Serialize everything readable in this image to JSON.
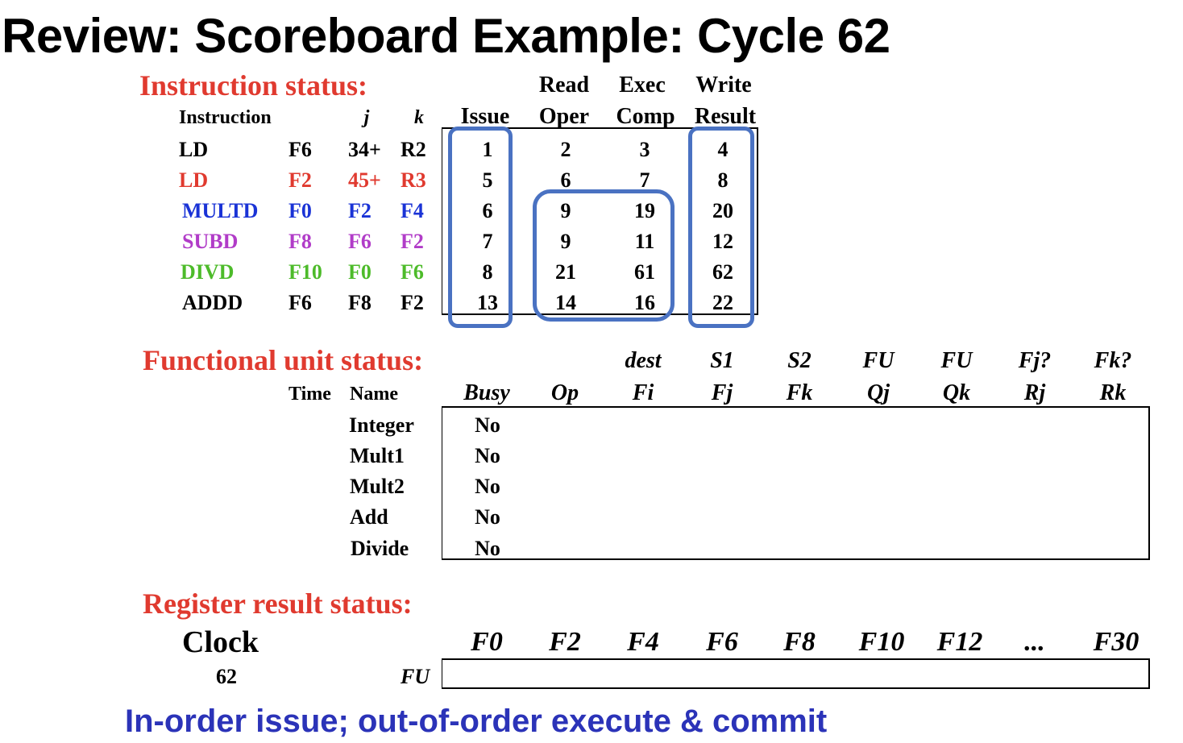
{
  "title": "Review: Scoreboard Example: Cycle 62",
  "colors": {
    "section": "#e03a2f",
    "highlight": "#4a72c2",
    "note": "#2b33b8",
    "row_colors": [
      "#000000",
      "#e03a2f",
      "#1a33d6",
      "#b13cc8",
      "#4dbb2a",
      "#000000"
    ]
  },
  "instruction_status": {
    "label": "Instruction status:",
    "headers": {
      "instruction": "Instruction",
      "j": "j",
      "k": "k",
      "issue": "Issue",
      "read_top": "Read",
      "read_bottom": "Oper",
      "exec_top": "Exec",
      "exec_bottom": "Comp",
      "write_top": "Write",
      "write_bottom": "Result"
    },
    "rows": [
      {
        "op": "LD",
        "dest": "F6",
        "j": "34+",
        "k": "R2",
        "issue": "1",
        "read": "2",
        "exec": "3",
        "write": "4"
      },
      {
        "op": "LD",
        "dest": "F2",
        "j": "45+",
        "k": "R3",
        "issue": "5",
        "read": "6",
        "exec": "7",
        "write": "8"
      },
      {
        "op": "MULTD",
        "dest": "F0",
        "j": "F2",
        "k": "F4",
        "issue": "6",
        "read": "9",
        "exec": "19",
        "write": "20"
      },
      {
        "op": "SUBD",
        "dest": "F8",
        "j": "F6",
        "k": "F2",
        "issue": "7",
        "read": "9",
        "exec": "11",
        "write": "12"
      },
      {
        "op": "DIVD",
        "dest": "F10",
        "j": "F0",
        "k": "F6",
        "issue": "8",
        "read": "21",
        "exec": "61",
        "write": "62"
      },
      {
        "op": "ADDD",
        "dest": "F6",
        "j": "F8",
        "k": "F2",
        "issue": "13",
        "read": "14",
        "exec": "16",
        "write": "22"
      }
    ]
  },
  "functional_unit_status": {
    "label": "Functional unit status:",
    "headers_top": {
      "dest": "dest",
      "s1": "S1",
      "s2": "S2",
      "fuj": "FU",
      "fuk": "FU",
      "fjq": "Fj?",
      "fkq": "Fk?"
    },
    "headers_bottom": {
      "time": "Time",
      "name": "Name",
      "busy": "Busy",
      "op": "Op",
      "fi": "Fi",
      "fj": "Fj",
      "fk": "Fk",
      "qj": "Qj",
      "qk": "Qk",
      "rj": "Rj",
      "rk": "Rk"
    },
    "units": [
      {
        "name": "Integer",
        "busy": "No"
      },
      {
        "name": "Mult1",
        "busy": "No"
      },
      {
        "name": "Mult2",
        "busy": "No"
      },
      {
        "name": "Add",
        "busy": "No"
      },
      {
        "name": "Divide",
        "busy": "No"
      }
    ]
  },
  "register_result_status": {
    "label": "Register result status:",
    "clock_label": "Clock",
    "clock_value": "62",
    "fu_label": "FU",
    "registers": [
      "F0",
      "F2",
      "F4",
      "F6",
      "F8",
      "F10",
      "F12",
      "...",
      "F30"
    ]
  },
  "note": "In-order issue; out-of-order execute & commit"
}
